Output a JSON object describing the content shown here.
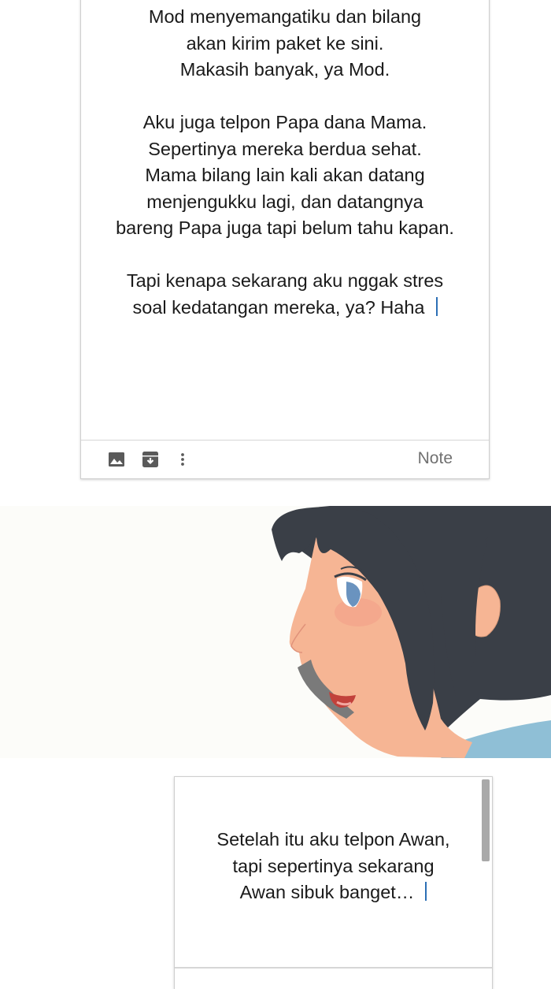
{
  "top_note": {
    "lines": [
      "Mod menyemangatiku dan bilang",
      "akan kirim paket ke sini.",
      "Makasih banyak, ya Mod.",
      "",
      "Aku juga telpon Papa dana Mama.",
      "Sepertinya mereka berdua sehat.",
      "Mama bilang lain kali akan datang",
      "menjengukku lagi, dan datangnya",
      "bareng Papa juga tapi belum tahu kapan.",
      "",
      "Tapi kenapa sekarang aku nggak stres",
      "soal kedatangan mereka, ya? Haha"
    ],
    "toolbar": {
      "icons": [
        "image-icon",
        "archive-icon",
        "more-vert-icon"
      ],
      "label": "Note"
    }
  },
  "bottom_note": {
    "lines": [
      "Setelah itu aku telpon Awan,",
      "tapi sepertinya sekarang",
      "Awan sibuk banget…"
    ]
  },
  "colors": {
    "caret": "#2c6fb5",
    "hair": "#3a3f47",
    "skin": "#f6b594",
    "shirt": "#8fbfd6",
    "panel_bg": "#fcfcf9"
  }
}
